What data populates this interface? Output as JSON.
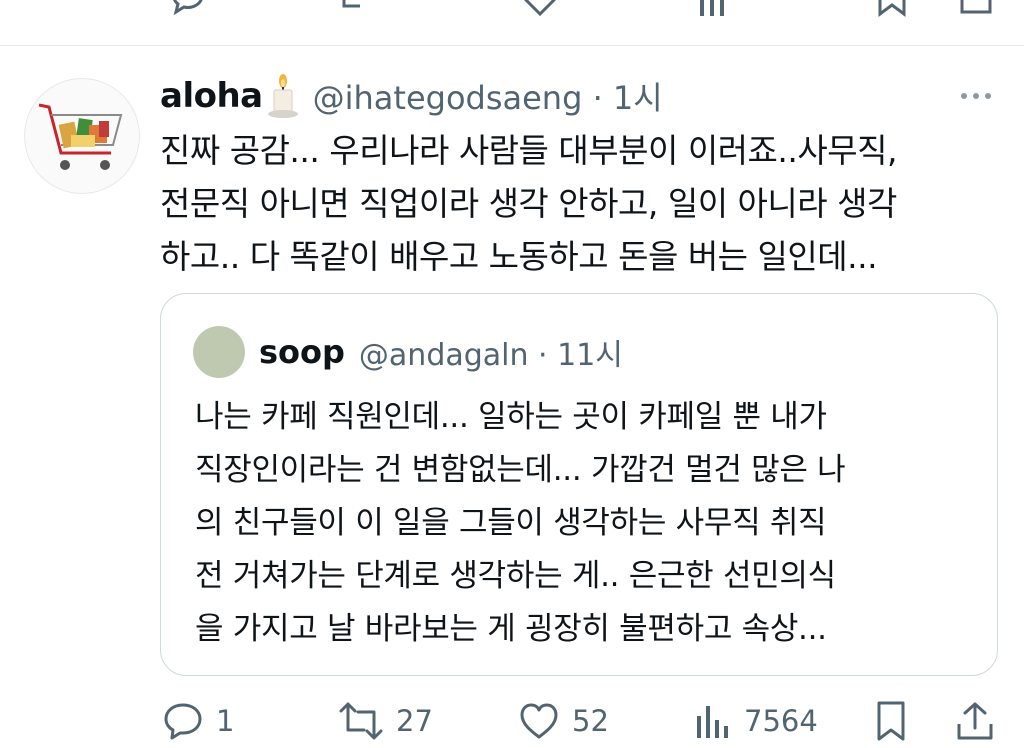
{
  "tweet": {
    "display_name": "aloha",
    "handle_time": "@ihategodsaeng · 1시",
    "text_lines": [
      "진짜 공감... 우리나라 사람들 대부분이 이러죠..사무직,",
      "전문직 아니면 직업이라 생각 안하고, 일이 아니라 생각",
      "하고.. 다 똑같이 배우고 노동하고 돈을 버는 일인데..."
    ]
  },
  "quoted": {
    "display_name": "soop",
    "handle_time": "@andagaln · 11시",
    "text_lines": [
      "나는 카페 직원인데... 일하는 곳이 카페일 뿐 내가",
      "직장인이라는 건 변함없는데... 가깝건 멀건 많은 나",
      "의 친구들이 이 일을 그들이 생각하는 사무직 취직",
      "전 거쳐가는 단계로 생각하는 게.. 은근한 선민의식",
      "을 가지고 날 바라보는 게 굉장히 불편하고 속상..."
    ]
  },
  "actions": {
    "replies": "1",
    "reposts": "27",
    "likes": "52",
    "views": "7564"
  },
  "icons": [
    "reply-icon",
    "repost-icon",
    "like-icon",
    "views-icon",
    "bookmark-icon",
    "share-icon",
    "more-icon",
    "candle-emoji"
  ]
}
